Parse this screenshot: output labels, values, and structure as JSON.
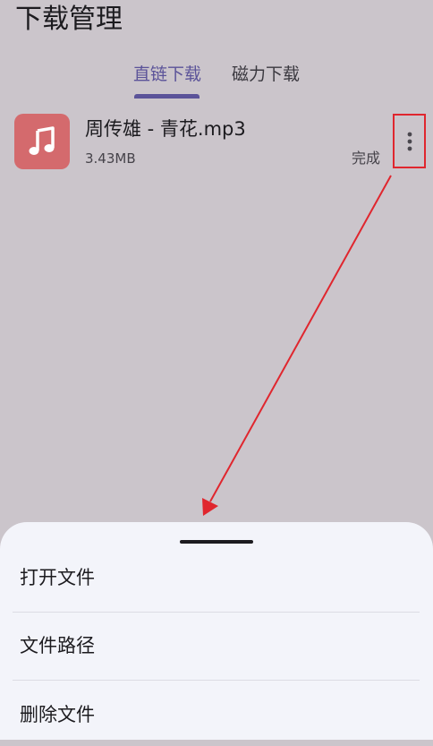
{
  "header": {
    "title": "下载管理"
  },
  "tabs": [
    {
      "label": "直链下载",
      "active": true
    },
    {
      "label": "磁力下载",
      "active": false
    }
  ],
  "downloads": [
    {
      "name": "周传雄 - 青花.mp3",
      "size": "3.43MB",
      "status": "完成",
      "icon": "music-note-icon",
      "icon_color": "#d46a6d"
    }
  ],
  "bottom_sheet": {
    "items": [
      {
        "label": "打开文件"
      },
      {
        "label": "文件路径"
      },
      {
        "label": "删除文件"
      }
    ]
  },
  "colors": {
    "accent": "#5b5399",
    "background": "#cbc5cb",
    "sheet": "#f3f4fa",
    "annotation": "#e0262e"
  }
}
